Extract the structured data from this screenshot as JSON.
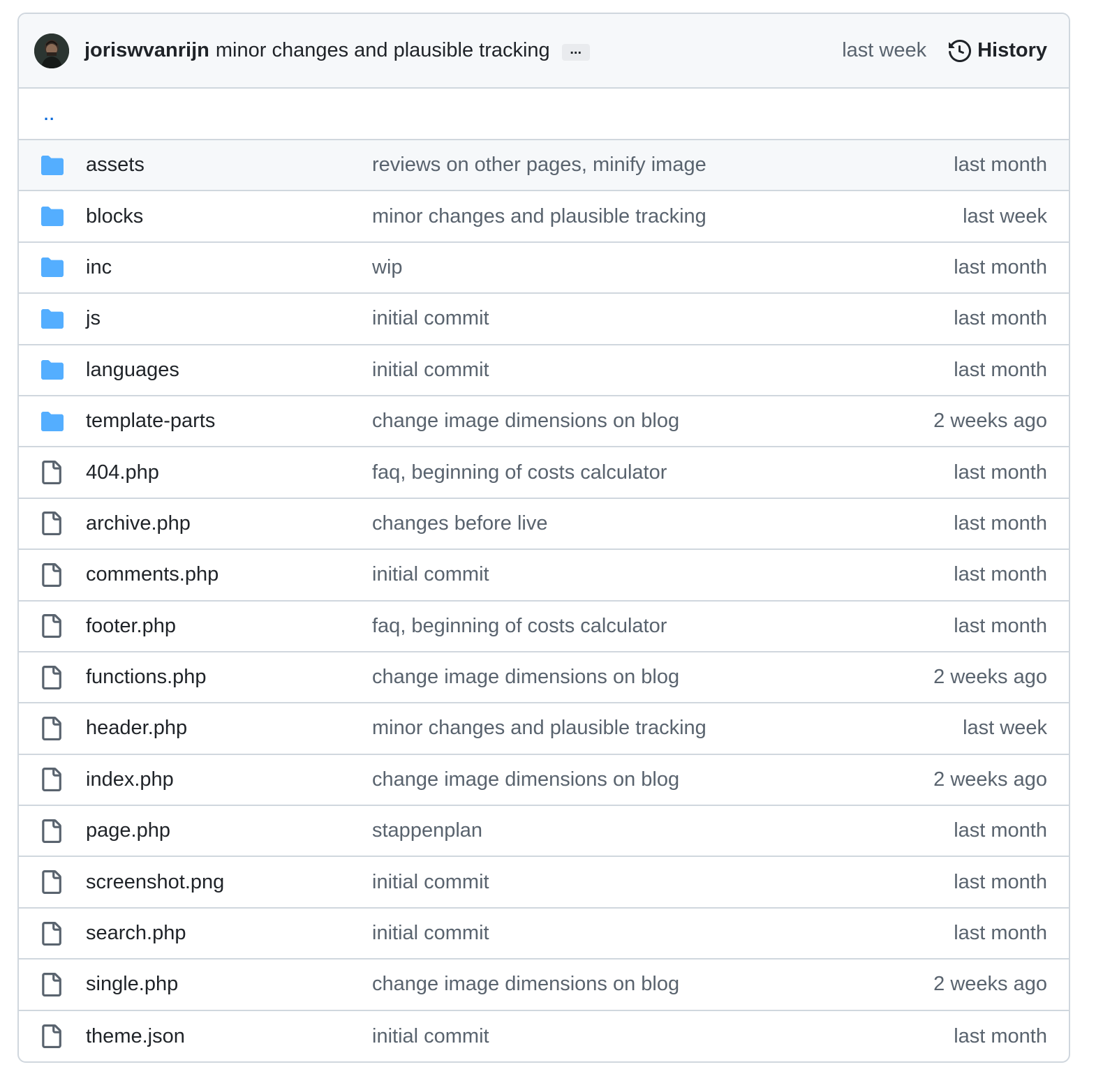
{
  "header": {
    "author": "joriswvanrijn",
    "message": "minor changes and plausible tracking",
    "ellipsis": "...",
    "date": "last week",
    "history_label": "History"
  },
  "parent_link": "..",
  "icons": {
    "folder": "folder-icon",
    "file": "file-icon",
    "history": "history-icon"
  },
  "colors": {
    "folder": "#54aeff",
    "link": "#0969da",
    "muted": "#59636e",
    "border": "#d0d7de",
    "header_bg": "#f6f8fa"
  },
  "rows": [
    {
      "type": "folder",
      "name": "assets",
      "message": "reviews on other pages, minify image",
      "date": "last month"
    },
    {
      "type": "folder",
      "name": "blocks",
      "message": "minor changes and plausible tracking",
      "date": "last week"
    },
    {
      "type": "folder",
      "name": "inc",
      "message": "wip",
      "date": "last month"
    },
    {
      "type": "folder",
      "name": "js",
      "message": "initial commit",
      "date": "last month"
    },
    {
      "type": "folder",
      "name": "languages",
      "message": "initial commit",
      "date": "last month"
    },
    {
      "type": "folder",
      "name": "template-parts",
      "message": "change image dimensions on blog",
      "date": "2 weeks ago"
    },
    {
      "type": "file",
      "name": "404.php",
      "message": "faq, beginning of costs calculator",
      "date": "last month"
    },
    {
      "type": "file",
      "name": "archive.php",
      "message": "changes before live",
      "date": "last month"
    },
    {
      "type": "file",
      "name": "comments.php",
      "message": "initial commit",
      "date": "last month"
    },
    {
      "type": "file",
      "name": "footer.php",
      "message": "faq, beginning of costs calculator",
      "date": "last month"
    },
    {
      "type": "file",
      "name": "functions.php",
      "message": "change image dimensions on blog",
      "date": "2 weeks ago"
    },
    {
      "type": "file",
      "name": "header.php",
      "message": "minor changes and plausible tracking",
      "date": "last week"
    },
    {
      "type": "file",
      "name": "index.php",
      "message": "change image dimensions on blog",
      "date": "2 weeks ago"
    },
    {
      "type": "file",
      "name": "page.php",
      "message": "stappenplan",
      "date": "last month"
    },
    {
      "type": "file",
      "name": "screenshot.png",
      "message": "initial commit",
      "date": "last month"
    },
    {
      "type": "file",
      "name": "search.php",
      "message": "initial commit",
      "date": "last month"
    },
    {
      "type": "file",
      "name": "single.php",
      "message": "change image dimensions on blog",
      "date": "2 weeks ago"
    },
    {
      "type": "file",
      "name": "theme.json",
      "message": "initial commit",
      "date": "last month"
    }
  ]
}
